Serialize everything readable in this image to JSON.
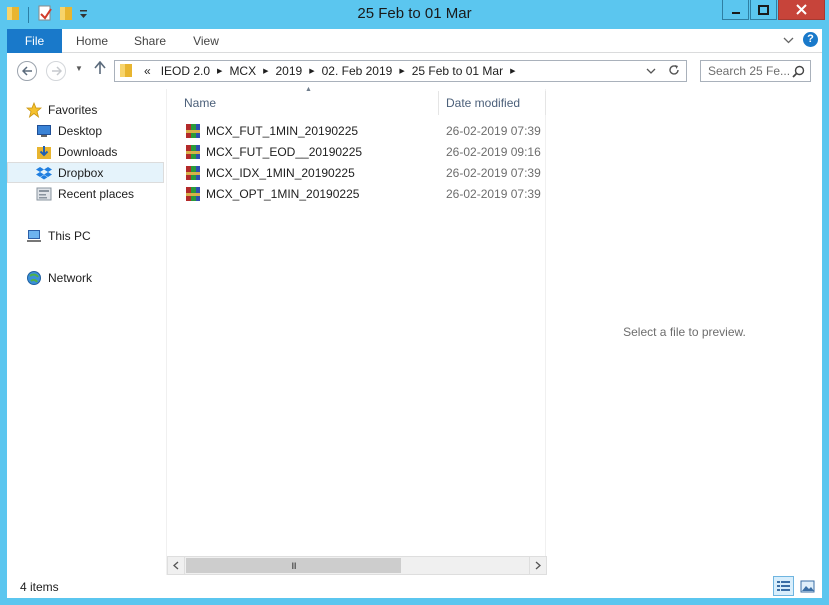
{
  "window": {
    "title": "25 Feb to 01 Mar",
    "minimize_icon": "minimize-icon",
    "maximize_icon": "maximize-icon",
    "close_icon": "close-icon"
  },
  "ribbon": {
    "tabs": [
      "File",
      "Home",
      "Share",
      "View"
    ],
    "accent_color": "#1979ca",
    "help_label": "?"
  },
  "address": {
    "overflow_label": "«",
    "crumbs": [
      "IEOD 2.0",
      "MCX",
      "2019",
      "02. Feb 2019",
      "25 Feb to 01 Mar"
    ],
    "search_placeholder": "Search 25 Fe..."
  },
  "nav_pane": {
    "favorites": "Favorites",
    "items": [
      "Desktop",
      "Downloads",
      "Dropbox",
      "Recent places"
    ],
    "selected": "Dropbox",
    "this_pc": "This PC",
    "network": "Network"
  },
  "file_list": {
    "columns": {
      "name": "Name",
      "date": "Date modified"
    },
    "rows": [
      {
        "name": "MCX_FUT_1MIN_20190225",
        "date": "26-02-2019 07:39"
      },
      {
        "name": "MCX_FUT_EOD__20190225",
        "date": "26-02-2019 09:16"
      },
      {
        "name": "MCX_IDX_1MIN_20190225",
        "date": "26-02-2019 07:39"
      },
      {
        "name": "MCX_OPT_1MIN_20190225",
        "date": "26-02-2019 07:39"
      }
    ],
    "scroll_thumb_grip": "III"
  },
  "preview": {
    "text": "Select a file to preview."
  },
  "status": {
    "item_count": "4 items"
  }
}
